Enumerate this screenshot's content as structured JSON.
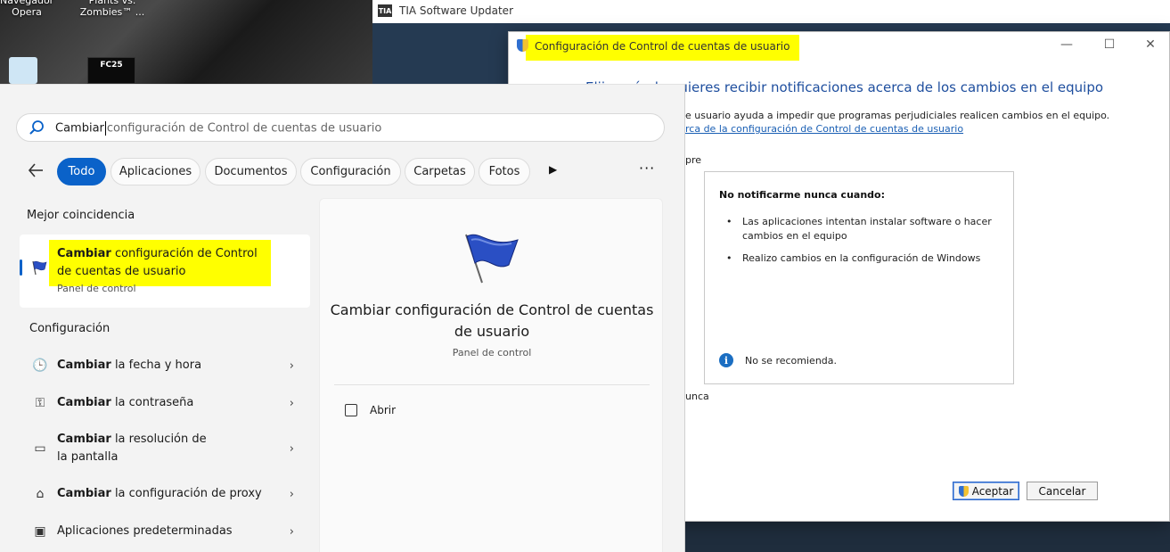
{
  "desktop": {
    "icon_opera": "Navegador\nOpera",
    "icon_pvz": "Plants vs.\nZombies™ ...",
    "icon_fc25": "FC25"
  },
  "tia": {
    "logo": "TIA",
    "title": "TIA Software Updater"
  },
  "uac": {
    "title": "Configuración de Control de cuentas de usuario",
    "minimize": "—",
    "maximize": "☐",
    "close": "✕",
    "heading": "Elija cuándo quieres recibir notificaciones acerca de los cambios en el equipo",
    "description": "e usuario ayuda a impedir que programas perjudiciales realicen cambios en el equipo.",
    "link": "rca de la configuración de Control de cuentas de usuario",
    "side_top": "pre",
    "side_bottom": "unca",
    "box_heading": "No notificarme nunca cuando:",
    "bullets": [
      "Las aplicaciones intentan instalar software o hacer cambios en el equipo",
      "Realizo cambios en la configuración de Windows"
    ],
    "info_text": "No se recomienda.",
    "ok": "Aceptar",
    "cancel": "Cancelar"
  },
  "search": {
    "query_typed": "Cambiar",
    "query_rest": "configuración de Control de cuentas de usuario",
    "filters": [
      "Todo",
      "Aplicaciones",
      "Documentos",
      "Configuración",
      "Carpetas",
      "Fotos"
    ],
    "best_match_heading": "Mejor coincidencia",
    "best_match": {
      "bold": "Cambiar",
      "rest": " configuración de Control de cuentas de usuario",
      "subtitle": "Panel de control"
    },
    "settings_heading": "Configuración",
    "settings": [
      {
        "bold": "Cambiar",
        "rest": " la fecha y hora"
      },
      {
        "bold": "Cambiar",
        "rest": " la contraseña"
      },
      {
        "bold": "Cambiar",
        "rest": " la resolución de la pantalla"
      },
      {
        "bold": "Cambiar",
        "rest": " la configuración de proxy"
      },
      {
        "bold": "",
        "rest": "Aplicaciones predeterminadas"
      }
    ]
  },
  "preview": {
    "title": "Cambiar configuración de Control de cuentas de usuario",
    "subtitle": "Panel de control",
    "open": "Abrir"
  }
}
